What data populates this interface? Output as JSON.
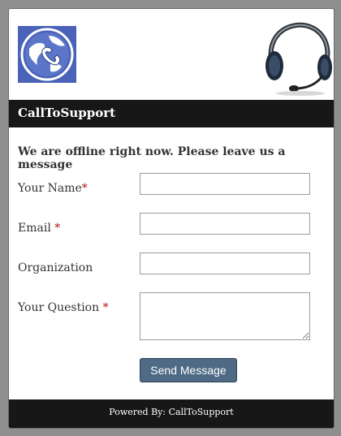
{
  "header": {
    "logo_icon": "globe-phone-icon",
    "headset_icon": "headset-icon",
    "title": "CallToSupport"
  },
  "form": {
    "offline_message": "We are offline right now. Please leave us a message",
    "required_marker": "*",
    "fields": {
      "name": {
        "label": "Your Name",
        "value": ""
      },
      "email": {
        "label": "Email ",
        "value": ""
      },
      "organization": {
        "label": "Organization",
        "value": ""
      },
      "question": {
        "label": "Your Question ",
        "value": ""
      }
    },
    "send_label": "Send Message"
  },
  "footer": {
    "text": "Powered By: CallToSupport"
  },
  "colors": {
    "bar": "#171717",
    "button": "#4f6a85",
    "required": "#b01414",
    "logo_bg": "#4a62b8"
  }
}
